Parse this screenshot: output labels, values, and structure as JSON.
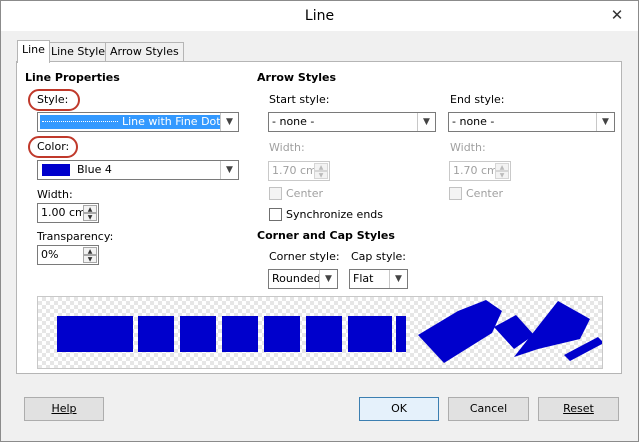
{
  "window": {
    "title": "Line",
    "close_glyph": "✕"
  },
  "tabs": [
    {
      "label": "Line",
      "active": true
    },
    {
      "label": "Line Styles",
      "active": false
    },
    {
      "label": "Arrow Styles",
      "active": false
    }
  ],
  "line_properties": {
    "heading": "Line Properties",
    "style_label": "Style:",
    "style_value": "Line with Fine Dots",
    "color_label": "Color:",
    "color_value": "Blue 4",
    "color_swatch": "#0000cc",
    "width_label": "Width:",
    "width_value": "1.00 cm",
    "transparency_label": "Transparency:",
    "transparency_value": "0%"
  },
  "arrow_styles": {
    "heading": "Arrow Styles",
    "start_style_label": "Start style:",
    "start_style_value": "- none -",
    "end_style_label": "End style:",
    "end_style_value": "- none -",
    "start_width_label": "Width:",
    "start_width_value": "1.70 cm",
    "end_width_label": "Width:",
    "end_width_value": "1.70 cm",
    "start_center_label": "Center",
    "end_center_label": "Center",
    "synchronize_label": "Synchronize ends"
  },
  "corner_cap": {
    "heading": "Corner and Cap Styles",
    "corner_label": "Corner style:",
    "corner_value": "Rounded",
    "cap_label": "Cap style:",
    "cap_value": "Flat"
  },
  "buttons": {
    "help": "Help",
    "ok": "OK",
    "cancel": "Cancel",
    "reset": "Reset"
  },
  "colors": {
    "line_blue": "#0000cc",
    "highlight_ring": "#c0392b",
    "selected_bg": "#3399ff"
  }
}
